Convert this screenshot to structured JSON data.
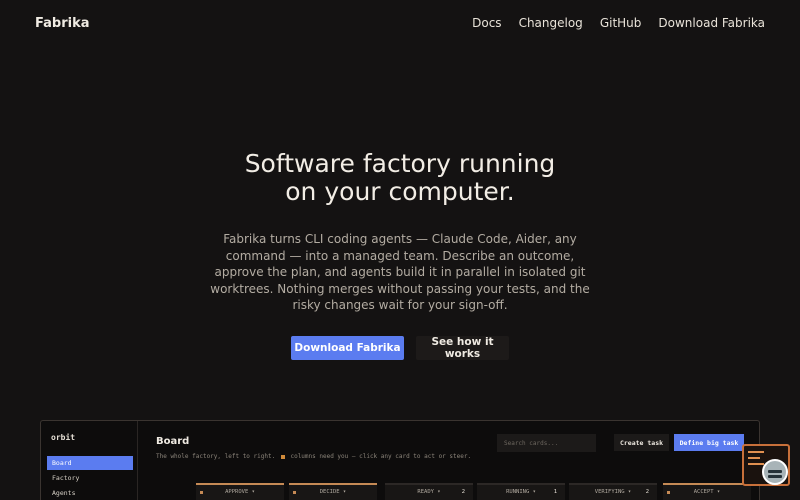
{
  "nav": {
    "brand": "Fabrika",
    "links": [
      "Docs",
      "Changelog",
      "GitHub",
      "Download Fabrika"
    ]
  },
  "hero": {
    "title_line1": "Software factory running",
    "title_line2": "on your computer.",
    "description": "Fabrika turns CLI coding agents — Claude Code, Aider, any command — into a managed team. Describe an outcome, approve the plan, and agents build it in parallel in isolated git worktrees. Nothing merges without passing your tests, and the risky changes wait for your sign-off.",
    "primary_button": "Download Fabrika",
    "secondary_button": "See how it works"
  },
  "preview": {
    "workspace": "orbit",
    "sidebar": [
      "Board",
      "Factory",
      "Agents"
    ],
    "title": "Board",
    "subtitle_before": "The whole factory, left to right.",
    "subtitle_after": "columns need you — click any card to act or steer.",
    "search_placeholder": "Search cards...",
    "create_button": "Create task",
    "define_button": "Define big task",
    "columns": [
      {
        "label": "APPROVE ▾",
        "count": "",
        "human": true
      },
      {
        "label": "DECIDE ▾",
        "count": "",
        "human": true
      },
      {
        "label": "READY ▾",
        "count": "2",
        "human": false
      },
      {
        "label": "RUNNING ▾",
        "count": "1",
        "human": false
      },
      {
        "label": "VERIFYING ▾",
        "count": "2",
        "human": false
      },
      {
        "label": "ACCEPT ▾",
        "count": "",
        "human": true
      }
    ]
  },
  "colors": {
    "background": "#141212",
    "accent": "#5b7cf0",
    "human_column": "#c58a55",
    "widget_border": "#c8703a"
  }
}
